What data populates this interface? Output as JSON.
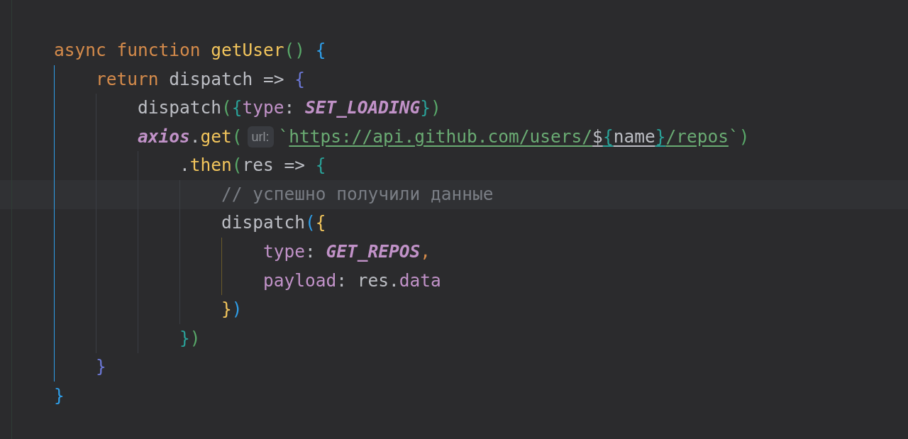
{
  "editor": {
    "lines": [
      {
        "current": false,
        "tokens": [
          {
            "kind": "plain",
            "color": "#d58b4b",
            "text": "async function "
          },
          {
            "kind": "plain",
            "color": "#f2c55c",
            "text": "getUser"
          },
          {
            "kind": "plain",
            "color": "#59a869",
            "text": "()"
          },
          {
            "kind": "plain",
            "color": "#2f9ee8",
            "text": " {"
          }
        ],
        "children": [
          {
            "current": false,
            "tokens": [
              {
                "kind": "plain",
                "color": "#d58b4b",
                "text": "return "
              },
              {
                "kind": "plain",
                "color": "#bcbec4",
                "text": "dispatch => "
              },
              {
                "kind": "plain",
                "color": "#6c78d6",
                "text": "{"
              }
            ],
            "children": [
              {
                "current": false,
                "tokens": [
                  {
                    "kind": "plain",
                    "color": "#bcbec4",
                    "text": "dispatch"
                  },
                  {
                    "kind": "plain",
                    "color": "#59a869",
                    "text": "("
                  },
                  {
                    "kind": "plain",
                    "color": "#2aa198",
                    "text": "{"
                  },
                  {
                    "kind": "plain",
                    "color": "#c192c8",
                    "text": "type"
                  },
                  {
                    "kind": "plain",
                    "color": "#bcbec4",
                    "text": ": "
                  },
                  {
                    "kind": "emphasis",
                    "color": "#c192c8",
                    "text": "SET_LOADING"
                  },
                  {
                    "kind": "plain",
                    "color": "#2aa198",
                    "text": "}"
                  },
                  {
                    "kind": "plain",
                    "color": "#59a869",
                    "text": ")"
                  }
                ]
              },
              {
                "current": false,
                "tokens": [
                  {
                    "kind": "emphasis",
                    "color": "#c192c8",
                    "text": "axios"
                  },
                  {
                    "kind": "plain",
                    "color": "#bcbec4",
                    "text": "."
                  },
                  {
                    "kind": "plain",
                    "color": "#f2c55c",
                    "text": "get"
                  },
                  {
                    "kind": "plain",
                    "color": "#59a869",
                    "text": "("
                  },
                  {
                    "kind": "hint",
                    "color": "#8c8f94",
                    "text": "url:"
                  },
                  {
                    "kind": "plain",
                    "color": "#6aab73",
                    "text": "`"
                  },
                  {
                    "kind": "link",
                    "color": "#6aab73",
                    "text": "https://api.github.com/users/"
                  },
                  {
                    "kind": "link",
                    "color": "#bcbec4",
                    "text": "$"
                  },
                  {
                    "kind": "link",
                    "color": "#2aa198",
                    "text": "{"
                  },
                  {
                    "kind": "link",
                    "color": "#bcbec4",
                    "text": "name"
                  },
                  {
                    "kind": "link",
                    "color": "#2aa198",
                    "text": "}"
                  },
                  {
                    "kind": "link",
                    "color": "#6aab73",
                    "text": "/repos"
                  },
                  {
                    "kind": "plain",
                    "color": "#6aab73",
                    "text": "`"
                  },
                  {
                    "kind": "plain",
                    "color": "#59a869",
                    "text": ")"
                  }
                ],
                "children": [
                  {
                    "current": false,
                    "tokens": [
                      {
                        "kind": "plain",
                        "color": "#bcbec4",
                        "text": "."
                      },
                      {
                        "kind": "plain",
                        "color": "#f2c55c",
                        "text": "then"
                      },
                      {
                        "kind": "plain",
                        "color": "#59a869",
                        "text": "("
                      },
                      {
                        "kind": "plain",
                        "color": "#bcbec4",
                        "text": "res => "
                      },
                      {
                        "kind": "plain",
                        "color": "#2aa198",
                        "text": "{"
                      }
                    ],
                    "children": [
                      {
                        "current": true,
                        "tokens": [
                          {
                            "kind": "plain",
                            "color": "#7a7e85",
                            "text": "// успешно получили данные"
                          }
                        ]
                      },
                      {
                        "current": false,
                        "tokens": [
                          {
                            "kind": "plain",
                            "color": "#bcbec4",
                            "text": "dispatch"
                          },
                          {
                            "kind": "plain",
                            "color": "#2f9ee8",
                            "text": "("
                          },
                          {
                            "kind": "plain",
                            "color": "#f2c55c",
                            "text": "{"
                          }
                        ],
                        "children": [
                          {
                            "current": false,
                            "tokens": [
                              {
                                "kind": "plain",
                                "color": "#c192c8",
                                "text": "type"
                              },
                              {
                                "kind": "plain",
                                "color": "#bcbec4",
                                "text": ": "
                              },
                              {
                                "kind": "emphasis",
                                "color": "#c192c8",
                                "text": "GET_REPOS"
                              },
                              {
                                "kind": "plain",
                                "color": "#d58b4b",
                                "text": ","
                              }
                            ]
                          },
                          {
                            "current": false,
                            "tokens": [
                              {
                                "kind": "plain",
                                "color": "#c192c8",
                                "text": "payload"
                              },
                              {
                                "kind": "plain",
                                "color": "#bcbec4",
                                "text": ": res."
                              },
                              {
                                "kind": "plain",
                                "color": "#c192c8",
                                "text": "data"
                              }
                            ]
                          }
                        ]
                      },
                      {
                        "current": false,
                        "tokens": [
                          {
                            "kind": "plain",
                            "color": "#f2c55c",
                            "text": "}"
                          },
                          {
                            "kind": "plain",
                            "color": "#2f9ee8",
                            "text": ")"
                          }
                        ]
                      }
                    ]
                  },
                  {
                    "current": false,
                    "tokens": [
                      {
                        "kind": "plain",
                        "color": "#2aa198",
                        "text": "}"
                      },
                      {
                        "kind": "plain",
                        "color": "#59a869",
                        "text": ")"
                      }
                    ]
                  }
                ]
              }
            ]
          },
          {
            "current": false,
            "tokens": [
              {
                "kind": "plain",
                "color": "#6c78d6",
                "text": "}"
              }
            ]
          }
        ]
      },
      {
        "current": false,
        "tokens": [
          {
            "kind": "plain",
            "color": "#2f9ee8",
            "text": "}"
          }
        ]
      }
    ]
  }
}
